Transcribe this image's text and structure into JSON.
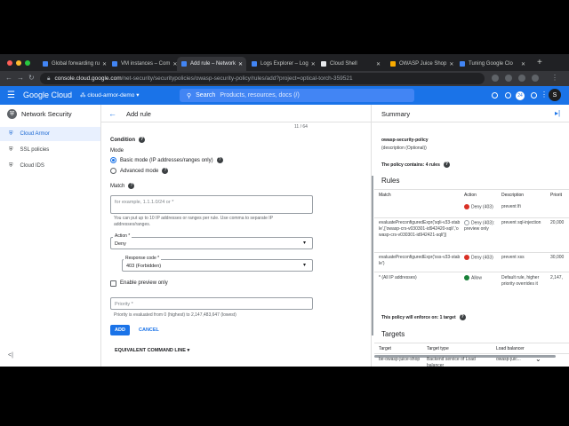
{
  "browser": {
    "tabs": [
      {
        "label": "Global forwarding ru",
        "color": "#4285f4"
      },
      {
        "label": "VM instances – Com",
        "color": "#4285f4"
      },
      {
        "label": "Add rule – Network",
        "color": "#4285f4"
      },
      {
        "label": "Logs Explorer – Log",
        "color": "#4285f4"
      },
      {
        "label": "Cloud Shell",
        "color": "#e8eaed"
      },
      {
        "label": "OWASP Juice Shop",
        "color": "#f9ab00"
      },
      {
        "label": "Tuning Google Clo",
        "color": "#4285f4"
      }
    ],
    "new_tab": "+",
    "url_host": "console.cloud.google.com",
    "url_path": "/net-security/securitypolicies/owasp-security-policy/rules/add?project=optical-torch-359521"
  },
  "header": {
    "logo": "Google Cloud",
    "project": "cloud-armor-demo",
    "search_label": "Search",
    "search_placeholder": "Products, resources, docs (/)",
    "badge": "24",
    "avatar": "S"
  },
  "sidebar": {
    "title": "Network Security",
    "items": [
      {
        "label": "Cloud Armor",
        "icon": "shield-icon"
      },
      {
        "label": "SSL policies",
        "icon": "lock-icon"
      },
      {
        "label": "Cloud IDS",
        "icon": "ids-icon"
      }
    ],
    "collapse": "<|"
  },
  "main": {
    "back": "←",
    "title": "Add rule",
    "counter": "11 / 64",
    "condition_label": "Condition",
    "mode_label": "Mode",
    "mode_basic": "Basic mode (IP addresses/ranges only)",
    "mode_advanced": "Advanced mode",
    "match_label": "Match",
    "match_placeholder": "for example, 1.1.1.0/24 or *",
    "match_help": "You can put up to 10 IP addresses or ranges per rule. Use comma to separate IP addresses/ranges.",
    "action_label": "Action *",
    "action_value": "Deny",
    "response_label": "Response code *",
    "response_value": "403 (Forbidden)",
    "preview_label": "Enable preview only",
    "priority_placeholder": "Priority *",
    "priority_help": "Priority is evaluated from 0 (highest) to 2,147,483,647 (lowest)",
    "add_button": "ADD",
    "cancel_button": "CANCEL",
    "equivalent_button": "EQUIVALENT COMMAND LINE"
  },
  "summary": {
    "title": "Summary",
    "policy_name": "owasp-security-policy",
    "policy_desc": "(description (Optional))",
    "rules_count": "The policy contains: 4 rules",
    "rules_heading": "Rules",
    "columns": [
      "Match",
      "Action",
      "Description",
      "Priorit"
    ],
    "rows": [
      {
        "match": "",
        "action": "Deny (403)",
        "action_type": "deny",
        "desc": "prevent lfi",
        "priority": ""
      },
      {
        "match": "evaluatePreconfiguredExpr('sqli-v33-stable',['owasp-crs-v030301-id942420-sqli','owasp-crs-v030301-id942421-sqli'])",
        "action": "Deny (403): preview only",
        "action_type": "preview",
        "desc": "prevent sql-injection",
        "priority": "20,000"
      },
      {
        "match": "evaluatePreconfiguredExpr('xss-v33-stable')",
        "action": "Deny (403)",
        "action_type": "deny",
        "desc": "prevent xss",
        "priority": "30,000"
      },
      {
        "match": "* (All IP addresses)",
        "action": "Allow",
        "action_type": "allow",
        "desc": "Default rule, higher priority overrides it",
        "priority": "2,147,"
      }
    ],
    "enforce_text": "This policy will enforce on: 1 target",
    "targets_heading": "Targets",
    "target_columns": [
      "Target",
      "Target type",
      "Load balancer"
    ],
    "target_row": {
      "target": "be-owasp-juice-shop",
      "type": "Backend service of Load balancer",
      "lb": "owasp-juic..."
    }
  }
}
